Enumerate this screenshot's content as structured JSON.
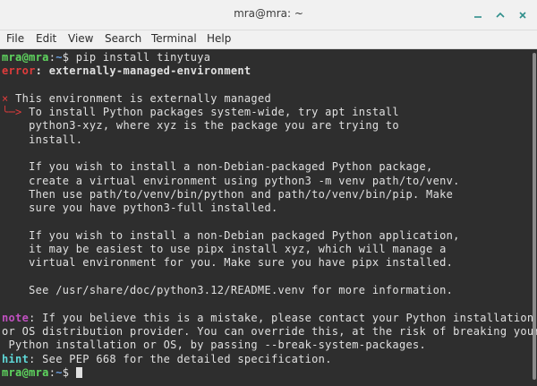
{
  "window": {
    "title": "mra@mra: ~",
    "buttons": {
      "minimize_icon": "minimize-icon",
      "maximize_icon": "maximize-icon",
      "close_icon": "close-icon"
    }
  },
  "menu": [
    "File",
    "Edit",
    "View",
    "Search",
    "Terminal",
    "Help"
  ],
  "terminal": {
    "prompt_user": "mra@mra",
    "prompt_sep": ":",
    "prompt_path": "~",
    "prompt_symbol": "$",
    "command": " pip install tinytuya",
    "error_label": "error",
    "error_msg": "externally-managed-environment",
    "x_mark": "×",
    "env_header": "This environment is externally managed",
    "arrow": "╰─>",
    "body": [
      " To install Python packages system-wide, try apt install",
      "    python3-xyz, where xyz is the package you are trying to",
      "    install.",
      "",
      "    If you wish to install a non-Debian-packaged Python package,",
      "    create a virtual environment using python3 -m venv path/to/venv.",
      "    Then use path/to/venv/bin/python and path/to/venv/bin/pip. Make",
      "    sure you have python3-full installed.",
      "",
      "    If you wish to install a non-Debian packaged Python application,",
      "    it may be easiest to use pipx install xyz, which will manage a",
      "    virtual environment for you. Make sure you have pipx installed.",
      "",
      "    See /usr/share/doc/python3.12/README.venv for more information.",
      ""
    ],
    "note_label": "note",
    "note_text": ": If you believe this is a mistake, please contact your Python installation",
    "note_lines": [
      "or OS distribution provider. You can override this, at the risk of breaking your",
      " Python installation or OS, by passing --break-system-packages."
    ],
    "hint_label": "hint",
    "hint_text": ": See PEP 668 for the detailed specification."
  },
  "colors": {
    "background": "#2e2e2e",
    "foreground": "#e0e0e0",
    "user": "#5fd75f",
    "path": "#6a9fe0",
    "error": "#e03c3c",
    "note": "#c050c0",
    "hint": "#5fd7d7"
  }
}
